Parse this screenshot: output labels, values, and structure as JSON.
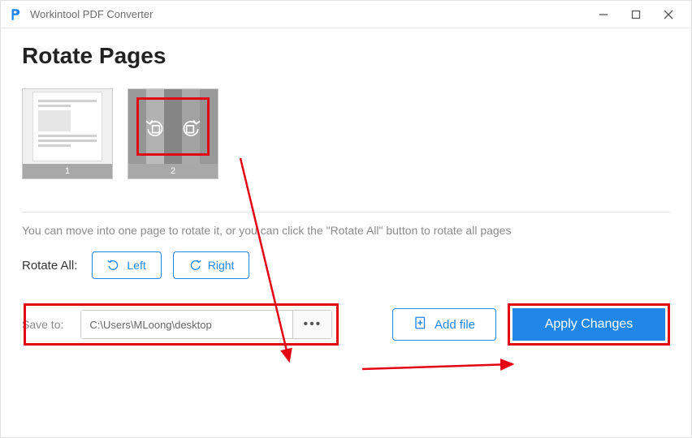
{
  "app": {
    "title": "Workintool PDF Converter"
  },
  "page": {
    "heading": "Rotate Pages",
    "hint": "You can move into one page to rotate it, or you can click the \"Rotate All\" button to rotate all pages"
  },
  "thumbs": {
    "page1_label": "1",
    "page2_label": "2"
  },
  "rotate_all": {
    "label": "Rotate All:",
    "left": "Left",
    "right": "Right"
  },
  "save": {
    "label": "Save to:",
    "path": "C:\\Users\\MLoong\\desktop",
    "browse": "•••"
  },
  "buttons": {
    "add_file": "Add file",
    "apply": "Apply Changes"
  }
}
